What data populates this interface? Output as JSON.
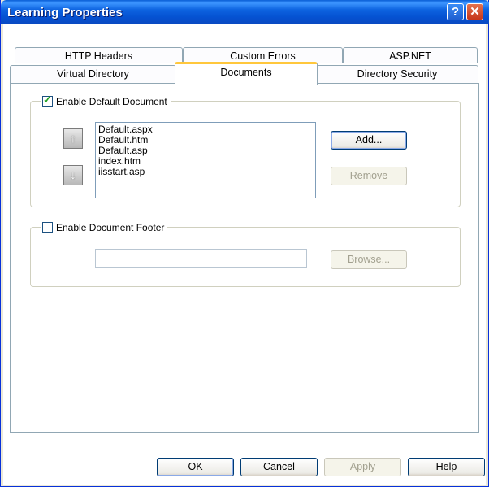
{
  "window": {
    "title": "Learning Properties"
  },
  "tabs": {
    "row1": [
      "HTTP Headers",
      "Custom Errors",
      "ASP.NET"
    ],
    "row2": [
      "Virtual Directory",
      "Documents",
      "Directory Security"
    ]
  },
  "default_document": {
    "label": "Enable Default Document",
    "checked": true,
    "files": [
      "Default.aspx",
      "Default.htm",
      "Default.asp",
      "index.htm",
      "iisstart.asp"
    ],
    "add_label": "Add...",
    "remove_label": "Remove",
    "move_up_icon": "arrow-up-icon",
    "move_down_icon": "arrow-down-icon"
  },
  "document_footer": {
    "label": "Enable Document Footer",
    "checked": false,
    "path_value": "",
    "browse_label": "Browse..."
  },
  "buttons": {
    "ok": "OK",
    "cancel": "Cancel",
    "apply": "Apply",
    "help": "Help"
  }
}
